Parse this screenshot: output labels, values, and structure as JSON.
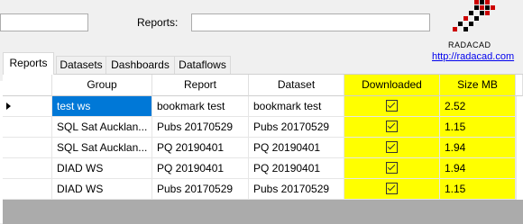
{
  "top": {
    "reports_label": "Reports:"
  },
  "logo": {
    "brand": "RADACAD",
    "url": "http://radacad.com"
  },
  "tabs": [
    {
      "label": "Reports"
    },
    {
      "label": "Datasets"
    },
    {
      "label": "Dashboards"
    },
    {
      "label": "Dataflows"
    }
  ],
  "table": {
    "headers": [
      "Group",
      "Report",
      "Dataset",
      "Downloaded",
      "Size MB"
    ],
    "rows": [
      {
        "group": "test ws",
        "report": "bookmark test",
        "dataset": "bookmark test",
        "downloaded": true,
        "size": "2.52"
      },
      {
        "group": "SQL Sat Aucklan...",
        "report": "Pubs 20170529",
        "dataset": "Pubs 20170529",
        "downloaded": true,
        "size": "1.15"
      },
      {
        "group": "SQL Sat Aucklan...",
        "report": "PQ 20190401",
        "dataset": "PQ 20190401",
        "downloaded": true,
        "size": "1.94"
      },
      {
        "group": "DIAD WS",
        "report": "PQ 20190401",
        "dataset": "PQ 20190401",
        "downloaded": true,
        "size": "1.94"
      },
      {
        "group": "DIAD WS",
        "report": "Pubs 20170529",
        "dataset": "Pubs 20170529",
        "downloaded": true,
        "size": "1.15"
      }
    ]
  },
  "colors": {
    "highlight": "#ffff00",
    "selection": "#0078d7"
  }
}
